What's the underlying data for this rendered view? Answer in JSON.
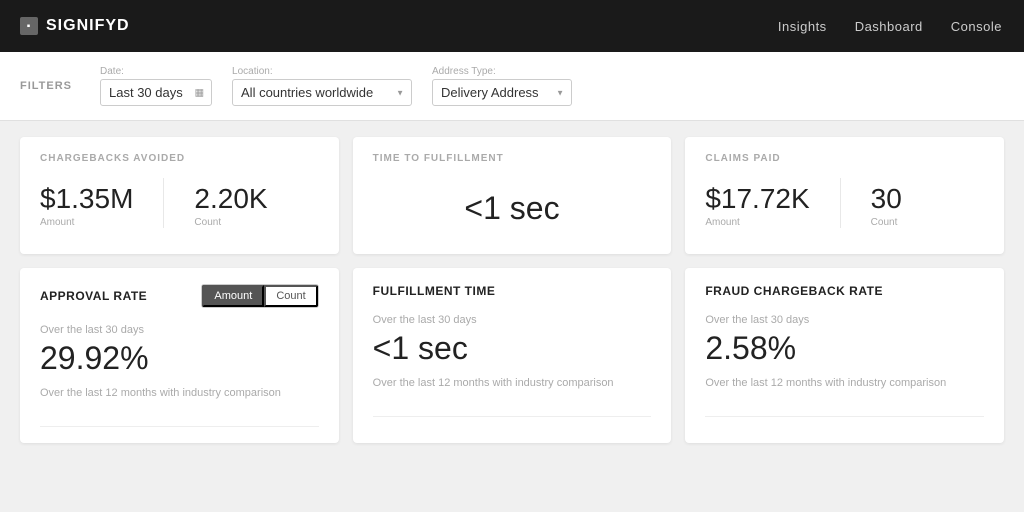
{
  "header": {
    "logo_text": "SIGNIFYD",
    "nav_items": [
      "Insights",
      "Dashboard",
      "Console"
    ]
  },
  "filters": {
    "label": "FILTERS",
    "date_label": "Date:",
    "date_value": "Last 30 days",
    "location_label": "Location:",
    "location_value": "All countries worldwide",
    "address_type_label": "Address Type:",
    "address_type_value": "Delivery Address"
  },
  "top_cards": [
    {
      "title": "CHARGEBACKS AVOIDED",
      "has_split": true,
      "left_value": "$1.35M",
      "left_label": "Amount",
      "right_value": "2.20K",
      "right_label": "Count"
    },
    {
      "title": "TIME TO FULFILLMENT",
      "has_split": false,
      "center_value": "<1 sec"
    },
    {
      "title": "CLAIMS PAID",
      "has_split": true,
      "left_value": "$17.72K",
      "left_label": "Amount",
      "right_value": "30",
      "right_label": "Count"
    }
  ],
  "bottom_cards": [
    {
      "title": "APPROVAL RATE",
      "show_toggle": true,
      "toggle_options": [
        "Amount",
        "Count"
      ],
      "toggle_active": "Amount",
      "period_label": "Over the last 30 days",
      "big_value": "29.92%",
      "comparison_label": "Over the last 12 months with industry comparison"
    },
    {
      "title": "FULFILLMENT TIME",
      "show_toggle": false,
      "period_label": "Over the last 30 days",
      "big_value": "<1 sec",
      "comparison_label": "Over the last 12 months with industry comparison"
    },
    {
      "title": "FRAUD CHARGEBACK RATE",
      "show_toggle": false,
      "period_label": "Over the last 30 days",
      "big_value": "2.58%",
      "comparison_label": "Over the last 12 months with industry comparison"
    }
  ]
}
